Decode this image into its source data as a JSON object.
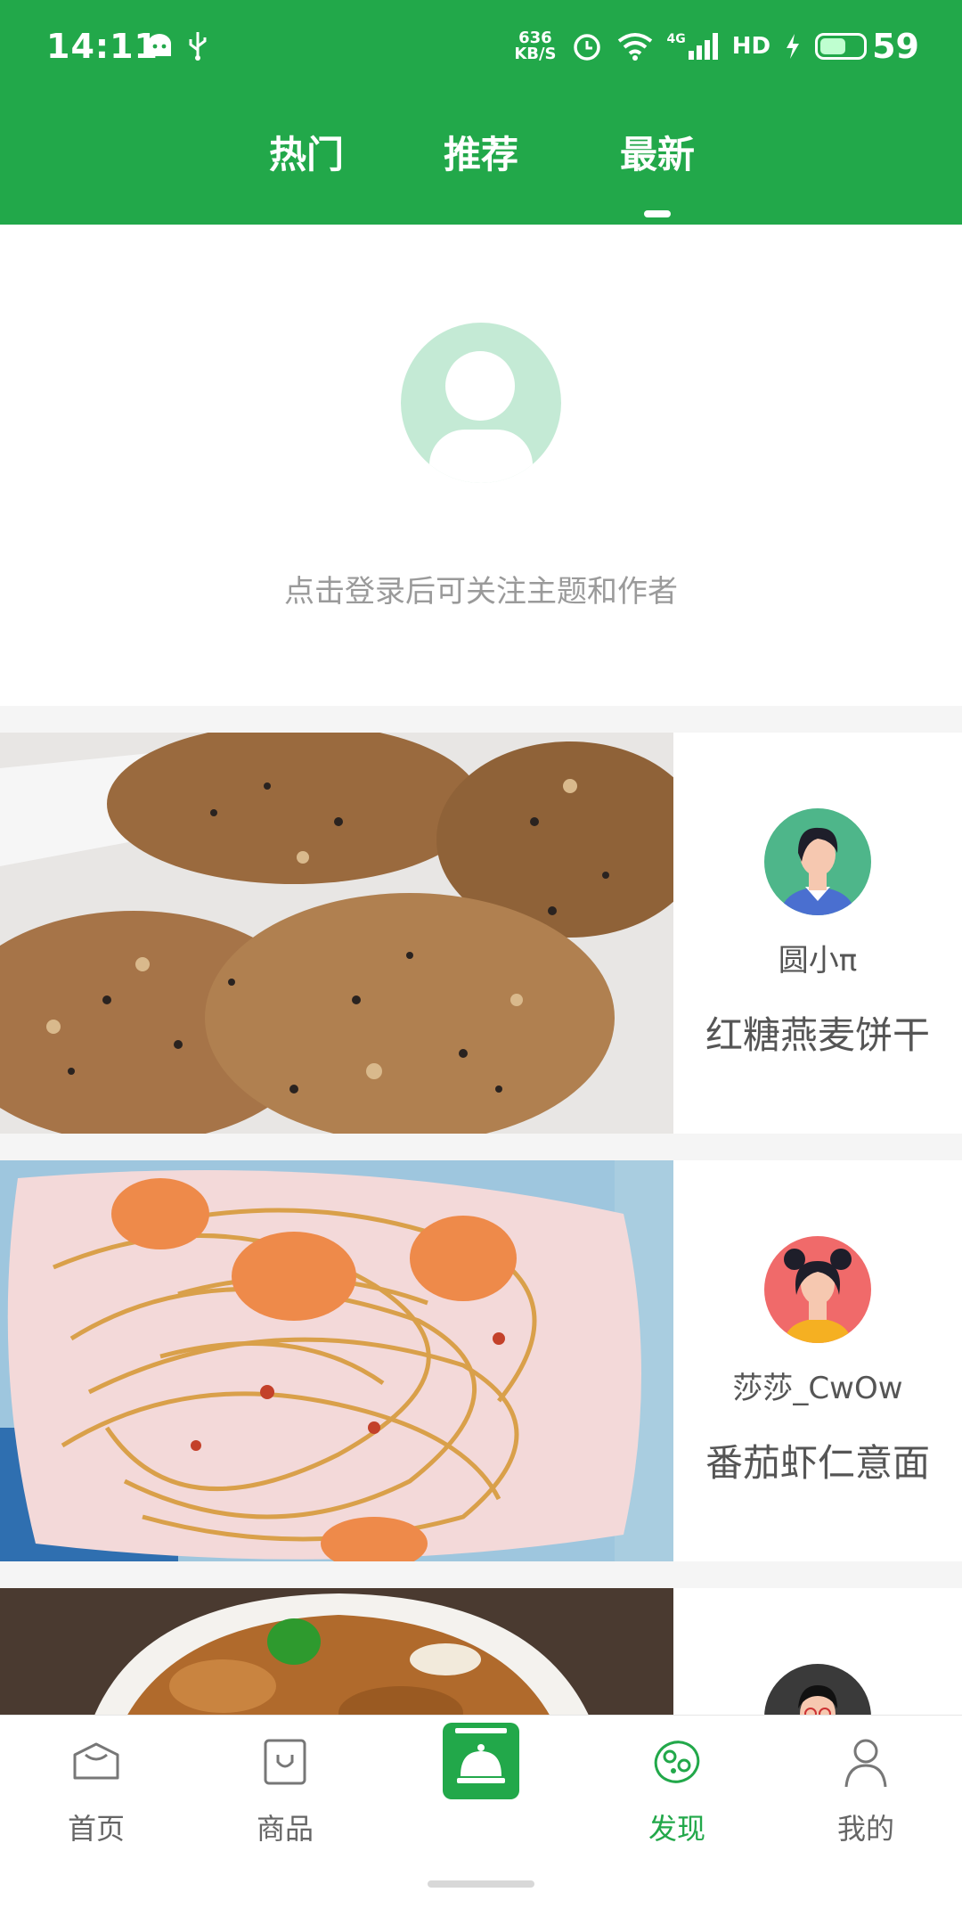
{
  "status_bar": {
    "time": "14:11",
    "speed_value": "636",
    "speed_unit": "KB/S",
    "network": "4G",
    "hd": "HD",
    "battery": "59",
    "battery_fraction": 0.59
  },
  "tabs": [
    {
      "label": "热门"
    },
    {
      "label": "推荐"
    },
    {
      "label": "最新",
      "active": true
    }
  ],
  "login_prompt": {
    "tip": "点击登录后可关注主题和作者"
  },
  "recipes": [
    {
      "author": "圆小π",
      "title": "红糖燕麦饼干",
      "avatar_color": "#4eb68a"
    },
    {
      "author": "莎莎_CwOw",
      "title": "番茄虾仁意面",
      "avatar_color": "#f06a6a"
    },
    {
      "author": "",
      "title": "",
      "avatar_color": "#3a3a3a"
    }
  ],
  "bottom_nav": [
    {
      "label": "首页",
      "icon": "graduation-cap-icon"
    },
    {
      "label": "商品",
      "icon": "shopping-bag-icon"
    },
    {
      "label": "",
      "icon": "recipe-book-icon"
    },
    {
      "label": "发现",
      "icon": "discover-icon",
      "active": true
    },
    {
      "label": "我的",
      "icon": "user-icon"
    }
  ],
  "colors": {
    "brand_green": "#22a84a",
    "avatar_placeholder": "#c4ead5",
    "text_gray": "#555555",
    "tip_gray": "#9a9a9a"
  }
}
